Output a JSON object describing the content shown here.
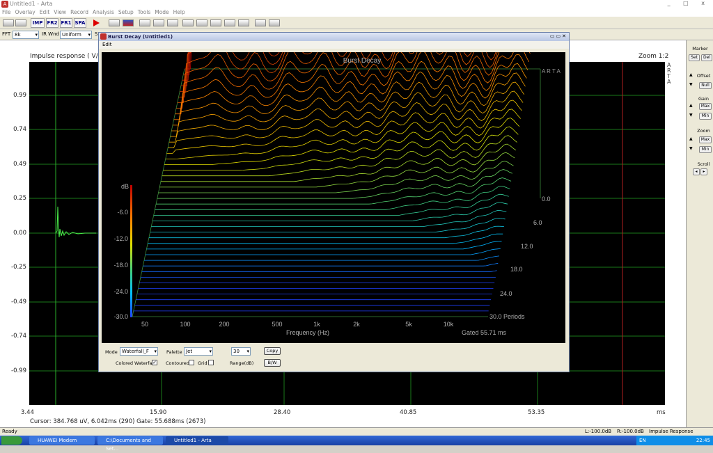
{
  "window": {
    "title": "Untitled1 - Arta",
    "controls": "_ □ x"
  },
  "menu": [
    "File",
    "Overlay",
    "Edit",
    "View",
    "Record",
    "Analysis",
    "Setup",
    "Tools",
    "Mode",
    "Help"
  ],
  "toolbar": [
    "IMP",
    "FR2",
    "FR1",
    "SPA"
  ],
  "toolbar2": {
    "fft_label": "FFT",
    "fft_value": "8k",
    "irwnd_label": "IR Wnd",
    "irwnd_value": "Uniform",
    "s_label": "S"
  },
  "impulse": {
    "title": "Impulse response ( V/V",
    "zoom": "Zoom 1:2",
    "brand": "A R T A",
    "y_ticks": [
      "0.99",
      "0.74",
      "0.49",
      "0.25",
      "0.00",
      "-0.25",
      "-0.49",
      "-0.74",
      "-0.99"
    ],
    "x_ticks": [
      "3.44",
      "15.90",
      "28.40",
      "40.85",
      "53.35"
    ],
    "x_unit": "ms",
    "cursor": "Cursor: 384.768 uV, 6.042ms (290)  Gate: 55.688ms (2673)"
  },
  "side_panel": {
    "marker": "Marker",
    "set": "Set",
    "del": "Del",
    "offset": "Offset",
    "null": "Null",
    "gain": "Gain",
    "gain_max": "Max",
    "gain_min": "Min",
    "zoom": "Zoom",
    "zoom_max": "Max",
    "zoom_min": "Min",
    "scroll": "Scroll"
  },
  "dialog": {
    "title": "Burst Decay  (Untitled1)",
    "menu": "Edit",
    "graph_title": "Burst Decay",
    "brand": "A R T A",
    "db_label": "dB",
    "db_ticks": [
      "-6.0",
      "-12.0",
      "-18.0",
      "-24.0",
      "-30.0"
    ],
    "x_ticks": [
      "50",
      "100",
      "200",
      "500",
      "1k",
      "2k",
      "5k",
      "10k"
    ],
    "x_label": "Frequency (Hz)",
    "gated": "Gated 55.71 ms",
    "period_ticks": [
      "0.0",
      "6.0",
      "12.0",
      "18.0",
      "24.0",
      "30.0 Periods"
    ],
    "mode_label": "Mode",
    "mode_value": "Waterfall_F",
    "palette_label": "Palette",
    "palette_value": "Jet",
    "range_value": "30",
    "range_label": "Range(dB)",
    "copy": "Copy",
    "bw": "B/W",
    "colored": "Colored Waterfall",
    "contoured": "Contoured",
    "grid": "Grid"
  },
  "status": {
    "ready": "Ready",
    "l": "L:-100.0dB",
    "r": "R:-100.0dB",
    "mode": "Impulse Response"
  },
  "taskbar": {
    "t1": "HUAWEI Modem",
    "t2": "C:\\Documents and Set...",
    "t3": "Untitled1 - Arta",
    "clock": "22:45",
    "lang": "EN"
  }
}
